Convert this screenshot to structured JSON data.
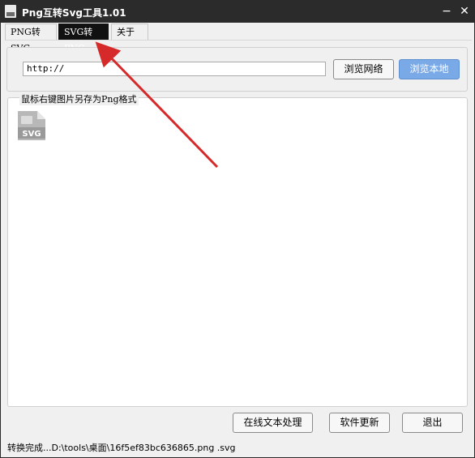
{
  "window": {
    "title": "Png互转Svg工具1.01",
    "minimize": "−",
    "close": "✕"
  },
  "tabs": [
    {
      "label": "PNG转SVG",
      "active": false
    },
    {
      "label": "SVG转PNG",
      "active": true
    },
    {
      "label": "关于",
      "active": false
    }
  ],
  "url_bar": {
    "value": "http://",
    "browse_web": "浏览网络",
    "browse_local": "浏览本地"
  },
  "preview": {
    "label": "鼠标右键图片另存为Png格式",
    "icon_text": "SVG"
  },
  "actions": {
    "online_text": "在线文本处理",
    "update": "软件更新",
    "exit": "退出"
  },
  "status": "转换完成...D:\\tools\\桌面\\16f5ef83bc636865.png .svg",
  "colors": {
    "titlebar": "#2b2b2b",
    "primary_button": "#79a9e6",
    "annotation_arrow": "#d62a2a"
  },
  "icons": [
    "app-icon",
    "minimize-icon",
    "close-icon",
    "svg-file-icon",
    "annotation-arrow"
  ]
}
